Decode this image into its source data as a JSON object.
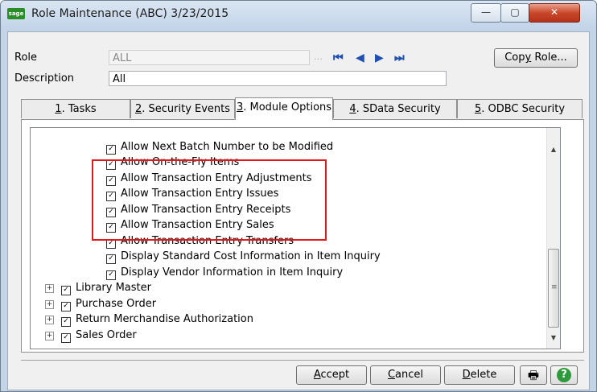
{
  "window": {
    "title": "Role Maintenance (ABC) 3/23/2015",
    "app_icon_text": "sage",
    "min_glyph": "—",
    "max_glyph": "▢",
    "close_glyph": "✕"
  },
  "form": {
    "role_label": "Role",
    "role_value": "ALL",
    "description_label": "Description",
    "description_value": "All",
    "lookup_glyph": "…",
    "nav": {
      "first": "⏮",
      "prev": "◀",
      "next": "▶",
      "last": "⏭"
    },
    "copy_role_prefix": "Cop",
    "copy_role_u": "y",
    "copy_role_suffix": " Role..."
  },
  "tabs": [
    {
      "num": "1",
      "label": ". Tasks"
    },
    {
      "num": "2",
      "label": ". Security Events"
    },
    {
      "num": "3",
      "label": ". Module Options"
    },
    {
      "num": "4",
      "label": ". SData Security"
    },
    {
      "num": "5",
      "label": ". ODBC Security"
    }
  ],
  "tree": {
    "items": [
      {
        "label": "Allow Next Batch Number to be Modified",
        "checked": true
      },
      {
        "label": "Allow On-the-Fly Items",
        "checked": true
      },
      {
        "label": "Allow Transaction Entry Adjustments",
        "checked": true
      },
      {
        "label": "Allow Transaction Entry Issues",
        "checked": true
      },
      {
        "label": "Allow Transaction Entry Receipts",
        "checked": true
      },
      {
        "label": "Allow Transaction Entry Sales",
        "checked": true
      },
      {
        "label": "Allow Transaction Entry Transfers",
        "checked": true
      },
      {
        "label": "Display Standard Cost Information in Item Inquiry",
        "checked": true
      },
      {
        "label": "Display Vendor Information in Item Inquiry",
        "checked": true
      }
    ],
    "modules": [
      {
        "label": "Library Master",
        "checked": true
      },
      {
        "label": "Purchase Order",
        "checked": true
      },
      {
        "label": "Return Merchandise Authorization",
        "checked": true
      },
      {
        "label": "Sales Order",
        "checked": true
      }
    ],
    "scroll_up": "▲",
    "scroll_down": "▼",
    "thumb_grip": "≡",
    "check_glyph": "✓",
    "expand_glyph": "+"
  },
  "buttons": {
    "accept_u": "A",
    "accept_rest": "ccept",
    "cancel_u": "C",
    "cancel_rest": "ancel",
    "delete_u": "D",
    "delete_rest": "elete",
    "print_glyph": "🖶",
    "help_glyph": "?"
  },
  "colors": {
    "highlight_box": "#e0191a",
    "title_bar": "#c1d3e8",
    "nav_arrows": "#1f4fb3"
  }
}
